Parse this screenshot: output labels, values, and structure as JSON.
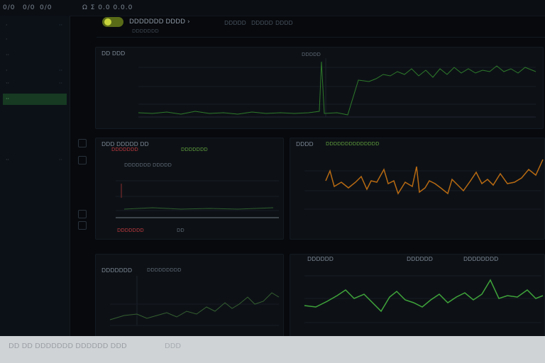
{
  "topbar": {
    "buttons": [
      "0/0",
      "0/0",
      "0/0"
    ],
    "tab": "Ω Σ 0.0 0.0.0"
  },
  "sidebar": {
    "items": [
      {
        "label": "·",
        "count": "··"
      },
      {
        "label": "·",
        "count": ""
      },
      {
        "label": "··",
        "count": ""
      },
      {
        "label": "·",
        "count": "··"
      },
      {
        "label": "··",
        "count": "··"
      },
      {
        "label": "··",
        "count": ""
      },
      {
        "label": "··",
        "count": "··"
      }
    ]
  },
  "dashboard": {
    "title": "DDDDDDD DDDD ›",
    "subtitle": "DDDDDDD",
    "menu": [
      "DDDDD",
      "DDDDD",
      "DDDD"
    ]
  },
  "panels": {
    "top": {
      "title": "DD DDD",
      "subtitle": "DDDDD",
      "tick": "DDDDD"
    },
    "mid_left": {
      "title": "DDD DDDDD DD",
      "sub_red": "DDDDDDD",
      "sub_green": "DDDDDDD",
      "legend": "DDDDDDD DDDDD",
      "bottom_red": "DDDDDDD",
      "bottom_tag": "DD"
    },
    "mid_right": {
      "title": "DDDD",
      "subtitle": "DDDDDDDDDDDDDD"
    },
    "bottom_left": {
      "title": "DDDDDDD",
      "subtitle": "DDDDDDDDD"
    },
    "bottom_right": {
      "title": "DDDDDD",
      "title2": "DDDDDD",
      "title3": "DDDDDDDD"
    }
  },
  "footer": {
    "text": "DD  DD  DDDDDDD DDDDDD  DDD",
    "button": "DDD"
  },
  "colors": {
    "green": "#3fa43a",
    "orange": "#b86a12",
    "red": "#b8383c",
    "accent": "#c8d43c"
  }
}
